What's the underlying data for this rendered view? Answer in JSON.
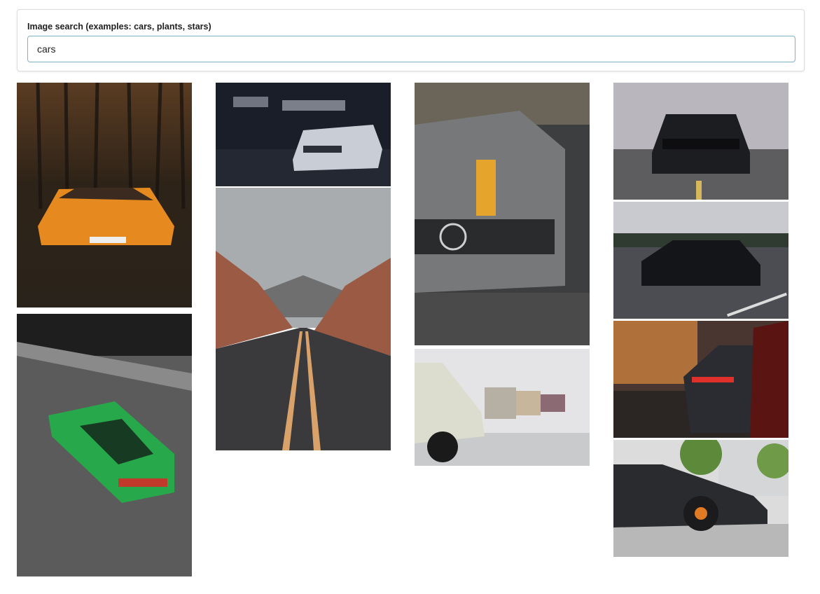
{
  "search": {
    "label": "Image search (examples: cars, plants, stars)",
    "value": "cars"
  },
  "results": [
    {
      "name": "orange-sports-car-forest-photo",
      "column": 1
    },
    {
      "name": "green-mustang-gt-photo",
      "column": 1
    },
    {
      "name": "white-camaro-garage-photo",
      "column": 2
    },
    {
      "name": "desert-road-canyon-photo",
      "column": 2
    },
    {
      "name": "grey-mercedes-yellow-stripe-photo",
      "column": 3
    },
    {
      "name": "classic-bmw-row-photo",
      "column": 3
    },
    {
      "name": "black-mustang-front-photo",
      "column": 4
    },
    {
      "name": "black-porsche-highway-photo",
      "column": 4
    },
    {
      "name": "red-taillights-street-photo",
      "column": 4
    },
    {
      "name": "black-lamborghini-side-photo",
      "column": 4
    }
  ]
}
